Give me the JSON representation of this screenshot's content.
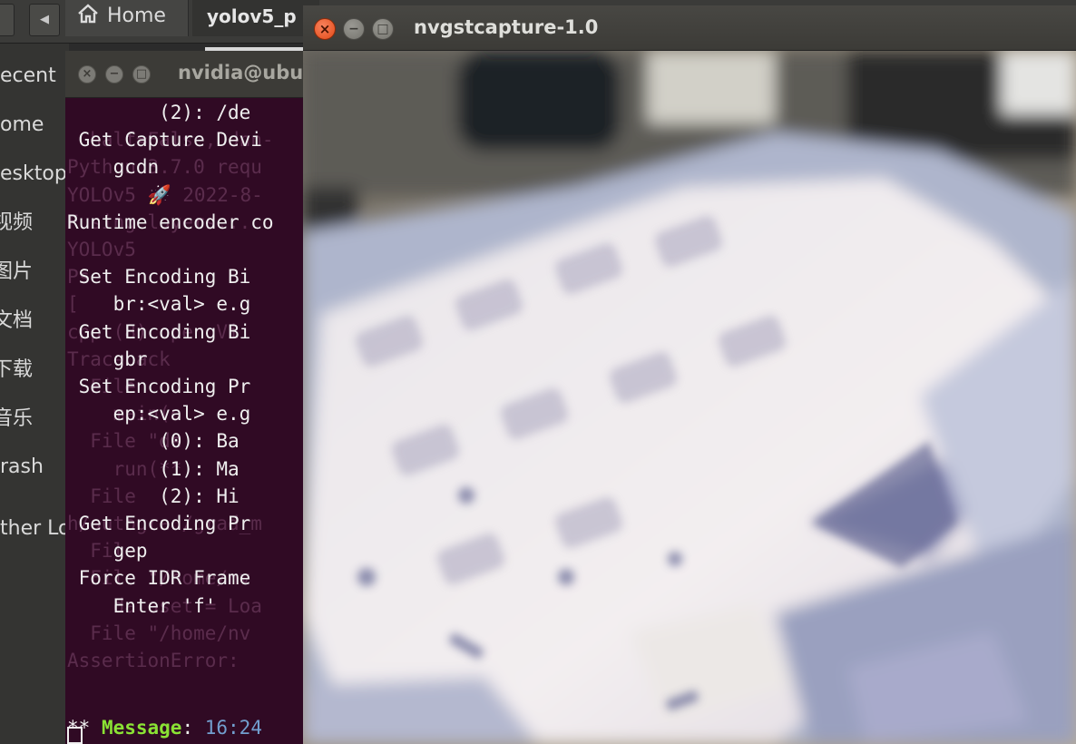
{
  "file_manager": {
    "home_label": "Home",
    "path_segment": "yolov5_p",
    "sidebar_items": [
      "ecent",
      "ome",
      "esktop",
      "视频",
      "图片",
      "文档",
      "下载",
      "音乐",
      "rash",
      "ther Lo"
    ]
  },
  "terminal": {
    "title": "nvidia@ubu",
    "foreground_lines": [
      "        (2): /de",
      " Get Capture Devi",
      "    gcdn",
      "",
      "Runtime encoder co",
      "",
      " Set Encoding Bi",
      "    br:<val> e.g",
      " Get Encoding Bi",
      "    gbr",
      " Set Encoding Pr",
      "    ep:<val> e.g",
      "        (0): Ba",
      "        (1): Ma",
      "        (2): Hi",
      " Get Encoding Pr",
      "    gep",
      " Force IDR Frame",
      "    Enter 'f'"
    ],
    "background_lines": [
      "  half=False, dnn-",
      "Python 3.7.0 requ",
      "YOLOv5 🚀 2022-8-",
      "Fusing layers...",
      "YOLOv5",
      "Ps",
      "[",
      "cpp (8) open Vi",
      "Traceback",
      "  File",
      "    main(o",
      "  File \"de",
      "    run(**",
      "  File",
      "h/autograd/grad_m",
      "  File",
      "  File \"/home/nv",
      "    dataset = Loa",
      "  File \"/home/nv",
      "AssertionError:"
    ],
    "message_prefix": "** ",
    "message_key": "Message",
    "message_sep": ": ",
    "message_time": "16:24"
  },
  "capture_window": {
    "title": "nvgstcapture-1.0",
    "close_glyph": "×",
    "minimize_glyph": "−",
    "maximize_glyph": "□"
  },
  "colors": {
    "terminal_bg": "#300a24",
    "message_key": "#8ae234",
    "message_time": "#729fcf",
    "close_button": "#e95420"
  }
}
